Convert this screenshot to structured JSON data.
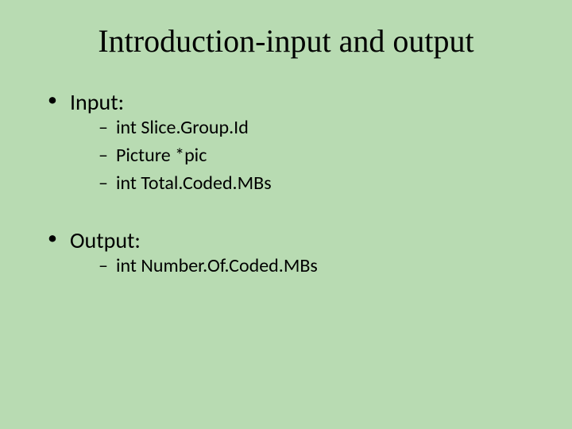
{
  "title": "Introduction-input and output",
  "sections": [
    {
      "heading": "Input:",
      "items": [
        "int Slice.Group.Id",
        "Picture *pic",
        "int Total.Coded.MBs"
      ]
    },
    {
      "heading": "Output:",
      "items": [
        "int Number.Of.Coded.MBs"
      ]
    }
  ]
}
